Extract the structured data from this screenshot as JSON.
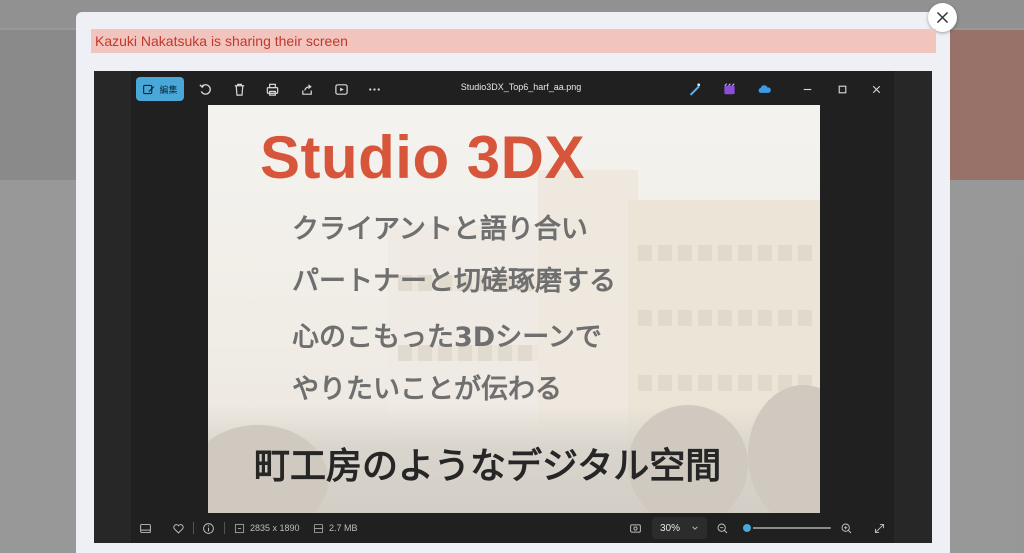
{
  "share": {
    "banner_text": "Kazuki Nakatsuka is sharing their screen",
    "banner_color": "#c0392b"
  },
  "viewer": {
    "edit_label": "編集",
    "file_name": "Studio3DX_Top6_harf_aa.png",
    "accent": "#4aa8d8",
    "toolbar_icons": [
      "edit-icon",
      "rotate-icon",
      "delete-icon",
      "print-icon",
      "share-icon",
      "slideshow-icon",
      "more-icon"
    ],
    "app_icons": [
      "designer-icon",
      "clipchamp-icon",
      "onedrive-icon"
    ],
    "window_controls": [
      "minimize-icon",
      "maximize-icon",
      "close-icon"
    ]
  },
  "image": {
    "brand": "Studio 3DX",
    "brand_color": "#d7553a",
    "lines": [
      "クライアントと語り合い",
      "パートナーと切磋琢磨する",
      "心のこもった3Dシーンで",
      "やりたいことが伝わる"
    ],
    "headline": "町工房のようなデジタル空間"
  },
  "status": {
    "dimensions": "2835 x 1890",
    "file_size": "2.7 MB",
    "zoom": "30%",
    "zoom_fraction": 0.04
  }
}
